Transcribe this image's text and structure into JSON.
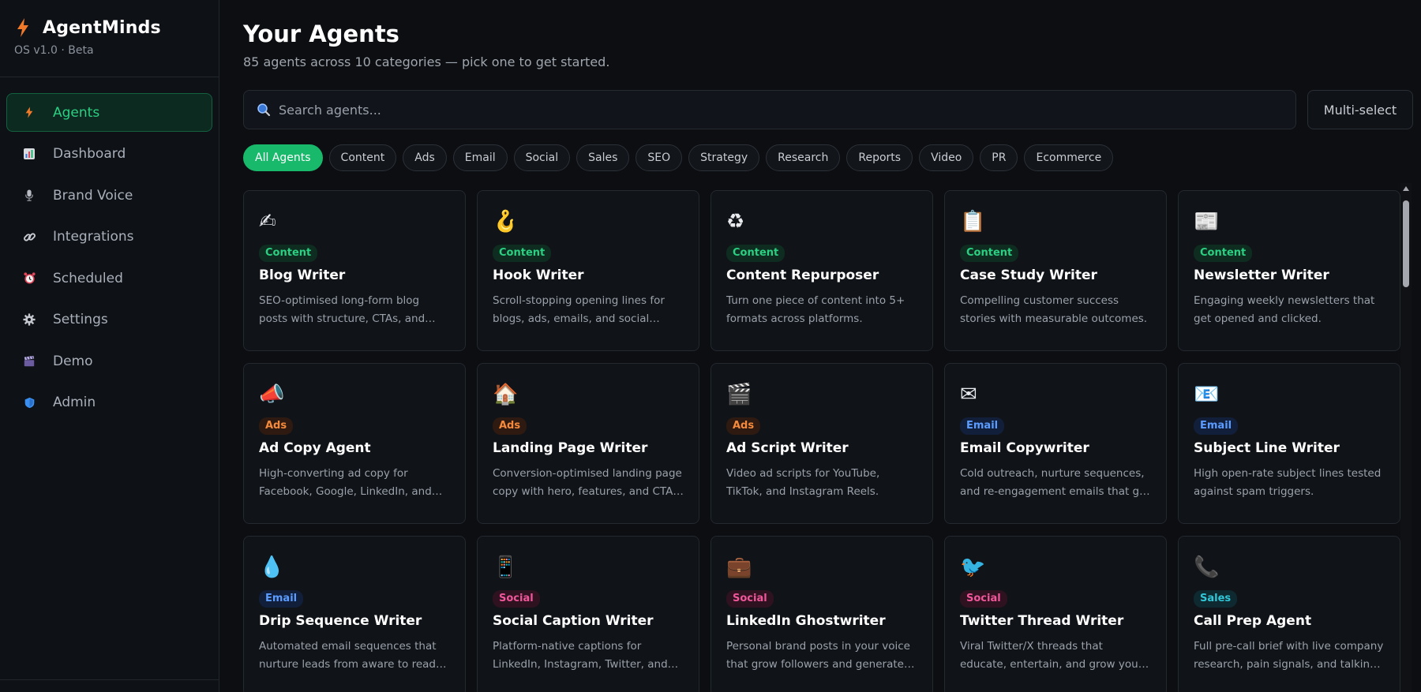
{
  "app": {
    "name": "AgentMinds",
    "version": "OS v1.0 · Beta"
  },
  "sidebar": {
    "items": [
      {
        "label": "Agents",
        "icon": "bolt-icon",
        "active": true
      },
      {
        "label": "Dashboard",
        "icon": "bar-chart-icon",
        "active": false
      },
      {
        "label": "Brand Voice",
        "icon": "microphone-icon",
        "active": false
      },
      {
        "label": "Integrations",
        "icon": "link-icon",
        "active": false
      },
      {
        "label": "Scheduled",
        "icon": "alarm-clock-icon",
        "active": false
      },
      {
        "label": "Settings",
        "icon": "gear-icon",
        "active": false
      },
      {
        "label": "Demo",
        "icon": "clapper-icon",
        "active": false
      },
      {
        "label": "Admin",
        "icon": "shield-icon",
        "active": false
      }
    ]
  },
  "header": {
    "title": "Your Agents",
    "subtitle": "85 agents across 10 categories — pick one to get started."
  },
  "search": {
    "placeholder": "Search agents...",
    "value": ""
  },
  "multi_select_label": "Multi-select",
  "filters": [
    "All Agents",
    "Content",
    "Ads",
    "Email",
    "Social",
    "Sales",
    "SEO",
    "Strategy",
    "Research",
    "Reports",
    "Video",
    "PR",
    "Ecommerce"
  ],
  "active_filter": "All Agents",
  "colors": {
    "accent": "#19b96b",
    "content": "#2bd082",
    "ads": "#f58a3c",
    "email": "#5a9cff",
    "social": "#f0569a",
    "sales": "#31c7d8"
  },
  "agents": [
    {
      "icon": "writing-hand-icon",
      "glyph": "✍",
      "tag": "Content",
      "tagClass": "content",
      "title": "Blog Writer",
      "desc": "SEO-optimised long-form blog posts with structure, CTAs, and internal links."
    },
    {
      "icon": "hook-icon",
      "glyph": "🪝",
      "tag": "Content",
      "tagClass": "content",
      "title": "Hook Writer",
      "desc": "Scroll-stopping opening lines for blogs, ads, emails, and social posts."
    },
    {
      "icon": "recycle-icon",
      "glyph": "♻",
      "tag": "Content",
      "tagClass": "content",
      "title": "Content Repurposer",
      "desc": "Turn one piece of content into 5+ formats across platforms."
    },
    {
      "icon": "clipboard-icon",
      "glyph": "📋",
      "tag": "Content",
      "tagClass": "content",
      "title": "Case Study Writer",
      "desc": "Compelling customer success stories with measurable outcomes."
    },
    {
      "icon": "newspaper-icon",
      "glyph": "📰",
      "tag": "Content",
      "tagClass": "content",
      "title": "Newsletter Writer",
      "desc": "Engaging weekly newsletters that get opened and clicked."
    },
    {
      "icon": "megaphone-icon",
      "glyph": "📣",
      "tag": "Ads",
      "tagClass": "ads",
      "title": "Ad Copy Agent",
      "desc": "High-converting ad copy for Facebook, Google, LinkedIn, and more."
    },
    {
      "icon": "house-icon",
      "glyph": "🏠",
      "tag": "Ads",
      "tagClass": "ads",
      "title": "Landing Page Writer",
      "desc": "Conversion-optimised landing page copy with hero, features, and CTA sections."
    },
    {
      "icon": "clapper-board-icon",
      "glyph": "🎬",
      "tag": "Ads",
      "tagClass": "ads",
      "title": "Ad Script Writer",
      "desc": "Video ad scripts for YouTube, TikTok, and Instagram Reels."
    },
    {
      "icon": "envelope-icon",
      "glyph": "✉",
      "tag": "Email",
      "tagClass": "email",
      "title": "Email Copywriter",
      "desc": "Cold outreach, nurture sequences, and re-engagement emails that get replies."
    },
    {
      "icon": "email-at-icon",
      "glyph": "📧",
      "tag": "Email",
      "tagClass": "email",
      "title": "Subject Line Writer",
      "desc": "High open-rate subject lines tested against spam triggers."
    },
    {
      "icon": "droplet-icon",
      "glyph": "💧",
      "tag": "Email",
      "tagClass": "email",
      "title": "Drip Sequence Writer",
      "desc": "Automated email sequences that nurture leads from aware to ready-to-buy."
    },
    {
      "icon": "phone-grid-icon",
      "glyph": "📱",
      "tag": "Social",
      "tagClass": "social",
      "title": "Social Caption Writer",
      "desc": "Platform-native captions for LinkedIn, Instagram, Twitter, and TikTok."
    },
    {
      "icon": "briefcase-icon",
      "glyph": "💼",
      "tag": "Social",
      "tagClass": "social",
      "title": "LinkedIn Ghostwriter",
      "desc": "Personal brand posts in your voice that grow followers and generate leads."
    },
    {
      "icon": "bird-icon",
      "glyph": "🐦",
      "tag": "Social",
      "tagClass": "social",
      "title": "Twitter Thread Writer",
      "desc": "Viral Twitter/X threads that educate, entertain, and grow your audience."
    },
    {
      "icon": "telephone-icon",
      "glyph": "📞",
      "tag": "Sales",
      "tagClass": "sales",
      "title": "Call Prep Agent",
      "desc": "Full pre-call brief with live company research, pain signals, and talking points."
    }
  ]
}
